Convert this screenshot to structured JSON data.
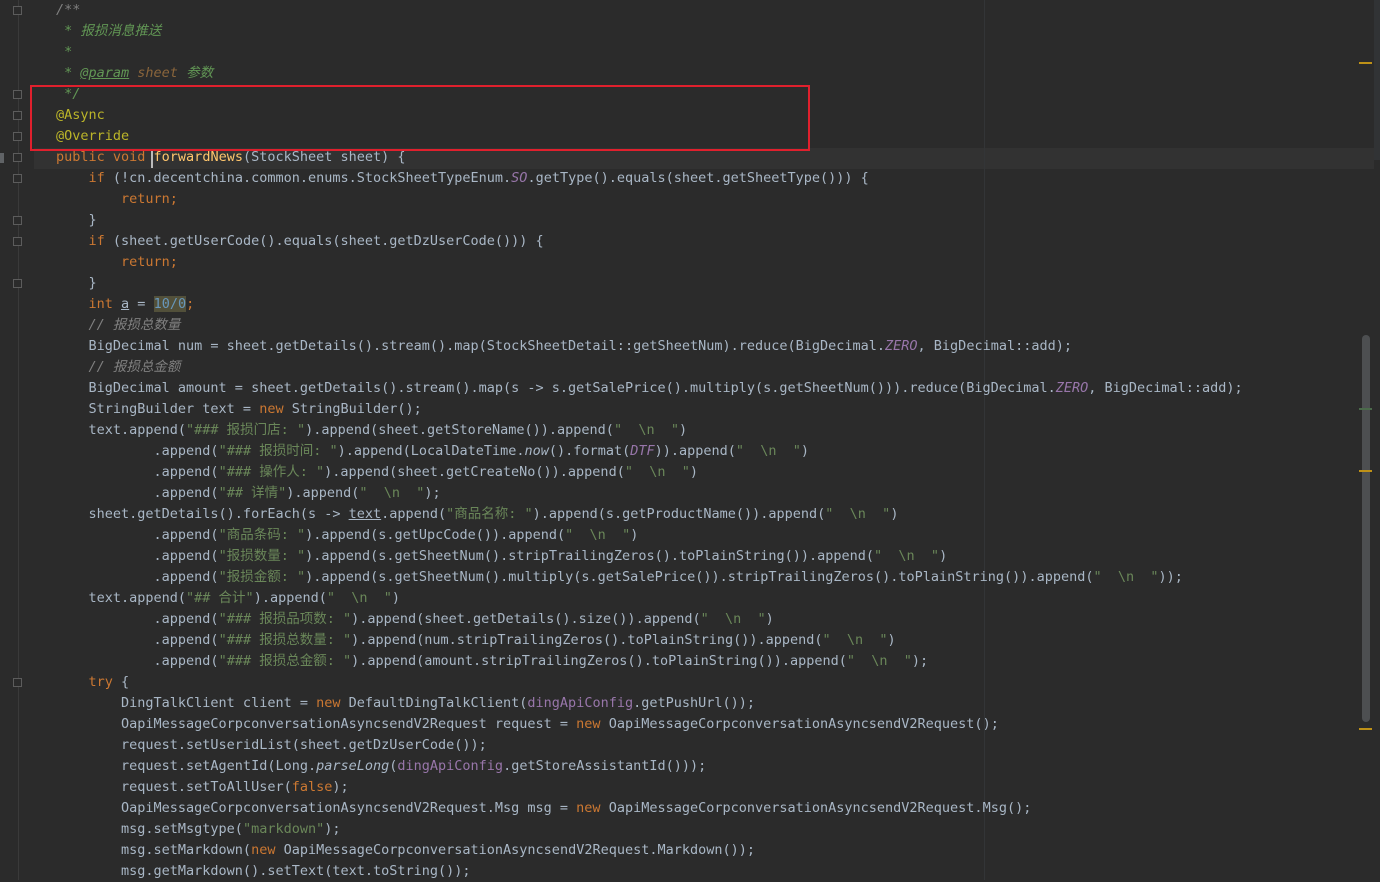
{
  "editor": {
    "language": "java",
    "lines": [
      [
        {
          "c": "cm",
          "t": "/**"
        }
      ],
      [
        {
          "c": "doc",
          "t": " * 报损消息推送"
        }
      ],
      [
        {
          "c": "doc",
          "t": " *"
        }
      ],
      [
        {
          "c": "doc",
          "t": " * "
        },
        {
          "c": "doctag",
          "t": "@param"
        },
        {
          "c": "docparam",
          "t": " sheet"
        },
        {
          "c": "doc",
          "t": " 参数"
        }
      ],
      [
        {
          "c": "doc",
          "t": " */"
        }
      ],
      [
        {
          "c": "ann",
          "t": "@Async"
        }
      ],
      [
        {
          "c": "ann",
          "t": "@Override"
        }
      ],
      [
        {
          "c": "kw",
          "t": "public void "
        },
        {
          "c": "fn",
          "t": "forwardNews"
        },
        {
          "c": "",
          "t": "(StockSheet sheet) {"
        }
      ],
      [
        {
          "c": "",
          "t": "    "
        },
        {
          "c": "kw",
          "t": "if"
        },
        {
          "c": "",
          "t": " (!cn.decentchina.common.enums.StockSheetTypeEnum."
        },
        {
          "c": "stat",
          "t": "SO"
        },
        {
          "c": "",
          "t": ".getType().equals(sheet.getSheetType())) {"
        }
      ],
      [
        {
          "c": "",
          "t": "        "
        },
        {
          "c": "kw",
          "t": "return;"
        }
      ],
      [
        {
          "c": "",
          "t": "    }"
        }
      ],
      [
        {
          "c": "",
          "t": "    "
        },
        {
          "c": "kw",
          "t": "if"
        },
        {
          "c": "",
          "t": " (sheet.getUserCode().equals(sheet.getDzUserCode())) {"
        }
      ],
      [
        {
          "c": "",
          "t": "        "
        },
        {
          "c": "kw",
          "t": "return;"
        }
      ],
      [
        {
          "c": "",
          "t": "    }"
        }
      ],
      [
        {
          "c": "",
          "t": "    "
        },
        {
          "c": "kw",
          "t": "int "
        },
        {
          "c": "ul",
          "t": "a"
        },
        {
          "c": "",
          "t": " = "
        },
        {
          "c": "num warn",
          "t": "10/0"
        },
        {
          "c": "kw",
          "t": ";"
        }
      ],
      [
        {
          "c": "",
          "t": "    "
        },
        {
          "c": "cm",
          "t": "// 报损总数量"
        }
      ],
      [
        {
          "c": "",
          "t": "    BigDecimal num = sheet.getDetails().stream().map(StockSheetDetail::getSheetNum).reduce(BigDecimal."
        },
        {
          "c": "stat",
          "t": "ZERO"
        },
        {
          "c": "",
          "t": ", BigDecimal::add);"
        }
      ],
      [
        {
          "c": "",
          "t": "    "
        },
        {
          "c": "cm",
          "t": "// 报损总金额"
        }
      ],
      [
        {
          "c": "",
          "t": "    BigDecimal amount = sheet.getDetails().stream().map(s -> s.getSalePrice().multiply(s.getSheetNum())).reduce(BigDecimal."
        },
        {
          "c": "stat",
          "t": "ZERO"
        },
        {
          "c": "",
          "t": ", BigDecimal::add);"
        }
      ],
      [
        {
          "c": "",
          "t": "    StringBuilder text = "
        },
        {
          "c": "kw",
          "t": "new"
        },
        {
          "c": "",
          "t": " StringBuilder();"
        }
      ],
      [
        {
          "c": "",
          "t": "    text.append("
        },
        {
          "c": "str",
          "t": "\"### 报损门店: \""
        },
        {
          "c": "",
          "t": ").append(sheet.getStoreName()).append("
        },
        {
          "c": "str",
          "t": "\"  \\n  \""
        },
        {
          "c": "",
          "t": ")"
        }
      ],
      [
        {
          "c": "",
          "t": "            .append("
        },
        {
          "c": "str",
          "t": "\"### 报损时间: \""
        },
        {
          "c": "",
          "t": ").append(LocalDateTime."
        },
        {
          "c": "it",
          "t": "now"
        },
        {
          "c": "",
          "t": "().format("
        },
        {
          "c": "stat",
          "t": "DTF"
        },
        {
          "c": "",
          "t": ")).append("
        },
        {
          "c": "str",
          "t": "\"  \\n  \""
        },
        {
          "c": "",
          "t": ")"
        }
      ],
      [
        {
          "c": "",
          "t": "            .append("
        },
        {
          "c": "str",
          "t": "\"### 操作人: \""
        },
        {
          "c": "",
          "t": ").append(sheet.getCreateNo()).append("
        },
        {
          "c": "str",
          "t": "\"  \\n  \""
        },
        {
          "c": "",
          "t": ")"
        }
      ],
      [
        {
          "c": "",
          "t": "            .append("
        },
        {
          "c": "str",
          "t": "\"## 详情\""
        },
        {
          "c": "",
          "t": ").append("
        },
        {
          "c": "str",
          "t": "\"  \\n  \""
        },
        {
          "c": "",
          "t": ");"
        }
      ],
      [
        {
          "c": "",
          "t": "    sheet.getDetails().forEach(s -> "
        },
        {
          "c": "ul",
          "t": "text"
        },
        {
          "c": "",
          "t": ".append("
        },
        {
          "c": "str",
          "t": "\"商品名称: \""
        },
        {
          "c": "",
          "t": ").append(s.getProductName()).append("
        },
        {
          "c": "str",
          "t": "\"  \\n  \""
        },
        {
          "c": "",
          "t": ")"
        }
      ],
      [
        {
          "c": "",
          "t": "            .append("
        },
        {
          "c": "str",
          "t": "\"商品条码: \""
        },
        {
          "c": "",
          "t": ").append(s.getUpcCode()).append("
        },
        {
          "c": "str",
          "t": "\"  \\n  \""
        },
        {
          "c": "",
          "t": ")"
        }
      ],
      [
        {
          "c": "",
          "t": "            .append("
        },
        {
          "c": "str",
          "t": "\"报损数量: \""
        },
        {
          "c": "",
          "t": ").append(s.getSheetNum().stripTrailingZeros().toPlainString()).append("
        },
        {
          "c": "str",
          "t": "\"  \\n  \""
        },
        {
          "c": "",
          "t": ")"
        }
      ],
      [
        {
          "c": "",
          "t": "            .append("
        },
        {
          "c": "str",
          "t": "\"报损金额: \""
        },
        {
          "c": "",
          "t": ").append(s.getSheetNum().multiply(s.getSalePrice()).stripTrailingZeros().toPlainString()).append("
        },
        {
          "c": "str",
          "t": "\"  \\n  \""
        },
        {
          "c": "",
          "t": "));"
        }
      ],
      [
        {
          "c": "",
          "t": "    text.append("
        },
        {
          "c": "str",
          "t": "\"## 合计\""
        },
        {
          "c": "",
          "t": ").append("
        },
        {
          "c": "str",
          "t": "\"  \\n  \""
        },
        {
          "c": "",
          "t": ")"
        }
      ],
      [
        {
          "c": "",
          "t": "            .append("
        },
        {
          "c": "str",
          "t": "\"### 报损品项数: \""
        },
        {
          "c": "",
          "t": ").append(sheet.getDetails().size()).append("
        },
        {
          "c": "str",
          "t": "\"  \\n  \""
        },
        {
          "c": "",
          "t": ")"
        }
      ],
      [
        {
          "c": "",
          "t": "            .append("
        },
        {
          "c": "str",
          "t": "\"### 报损总数量: \""
        },
        {
          "c": "",
          "t": ").append(num.stripTrailingZeros().toPlainString()).append("
        },
        {
          "c": "str",
          "t": "\"  \\n  \""
        },
        {
          "c": "",
          "t": ")"
        }
      ],
      [
        {
          "c": "",
          "t": "            .append("
        },
        {
          "c": "str",
          "t": "\"### 报损总金额: \""
        },
        {
          "c": "",
          "t": ").append(amount.stripTrailingZeros().toPlainString()).append("
        },
        {
          "c": "str",
          "t": "\"  \\n  \""
        },
        {
          "c": "",
          "t": ");"
        }
      ],
      [
        {
          "c": "",
          "t": "    "
        },
        {
          "c": "kw",
          "t": "try"
        },
        {
          "c": "",
          "t": " {"
        }
      ],
      [
        {
          "c": "",
          "t": "        DingTalkClient client = "
        },
        {
          "c": "kw",
          "t": "new"
        },
        {
          "c": "",
          "t": " DefaultDingTalkClient("
        },
        {
          "c": "fld",
          "t": "dingApiConfig"
        },
        {
          "c": "",
          "t": ".getPushUrl());"
        }
      ],
      [
        {
          "c": "",
          "t": "        OapiMessageCorpconversationAsyncsendV2Request request = "
        },
        {
          "c": "kw",
          "t": "new"
        },
        {
          "c": "",
          "t": " OapiMessageCorpconversationAsyncsendV2Request();"
        }
      ],
      [
        {
          "c": "",
          "t": "        request.setUseridList(sheet.getDzUserCode());"
        }
      ],
      [
        {
          "c": "",
          "t": "        request.setAgentId(Long."
        },
        {
          "c": "it",
          "t": "parseLong"
        },
        {
          "c": "",
          "t": "("
        },
        {
          "c": "fld",
          "t": "dingApiConfig"
        },
        {
          "c": "",
          "t": ".getStoreAssistantId()));"
        }
      ],
      [
        {
          "c": "",
          "t": "        request.setToAllUser("
        },
        {
          "c": "kw",
          "t": "false"
        },
        {
          "c": "",
          "t": ");"
        }
      ],
      [
        {
          "c": "",
          "t": "        OapiMessageCorpconversationAsyncsendV2Request.Msg msg = "
        },
        {
          "c": "kw",
          "t": "new"
        },
        {
          "c": "",
          "t": " OapiMessageCorpconversationAsyncsendV2Request.Msg();"
        }
      ],
      [
        {
          "c": "",
          "t": "        msg.setMsgtype("
        },
        {
          "c": "str",
          "t": "\"markdown\""
        },
        {
          "c": "",
          "t": ");"
        }
      ],
      [
        {
          "c": "",
          "t": "        msg.setMarkdown("
        },
        {
          "c": "kw",
          "t": "new"
        },
        {
          "c": "",
          "t": " OapiMessageCorpconversationAsyncsendV2Request.Markdown());"
        }
      ],
      [
        {
          "c": "",
          "t": "        msg.getMarkdown().setText(text.toString());"
        }
      ]
    ]
  },
  "colors": {
    "background": "#2b2b2b",
    "highlight_box": "#e0202d",
    "keyword": "#cc7832",
    "string": "#6a8759",
    "annotation": "#bbb529",
    "method": "#ffc66d"
  }
}
